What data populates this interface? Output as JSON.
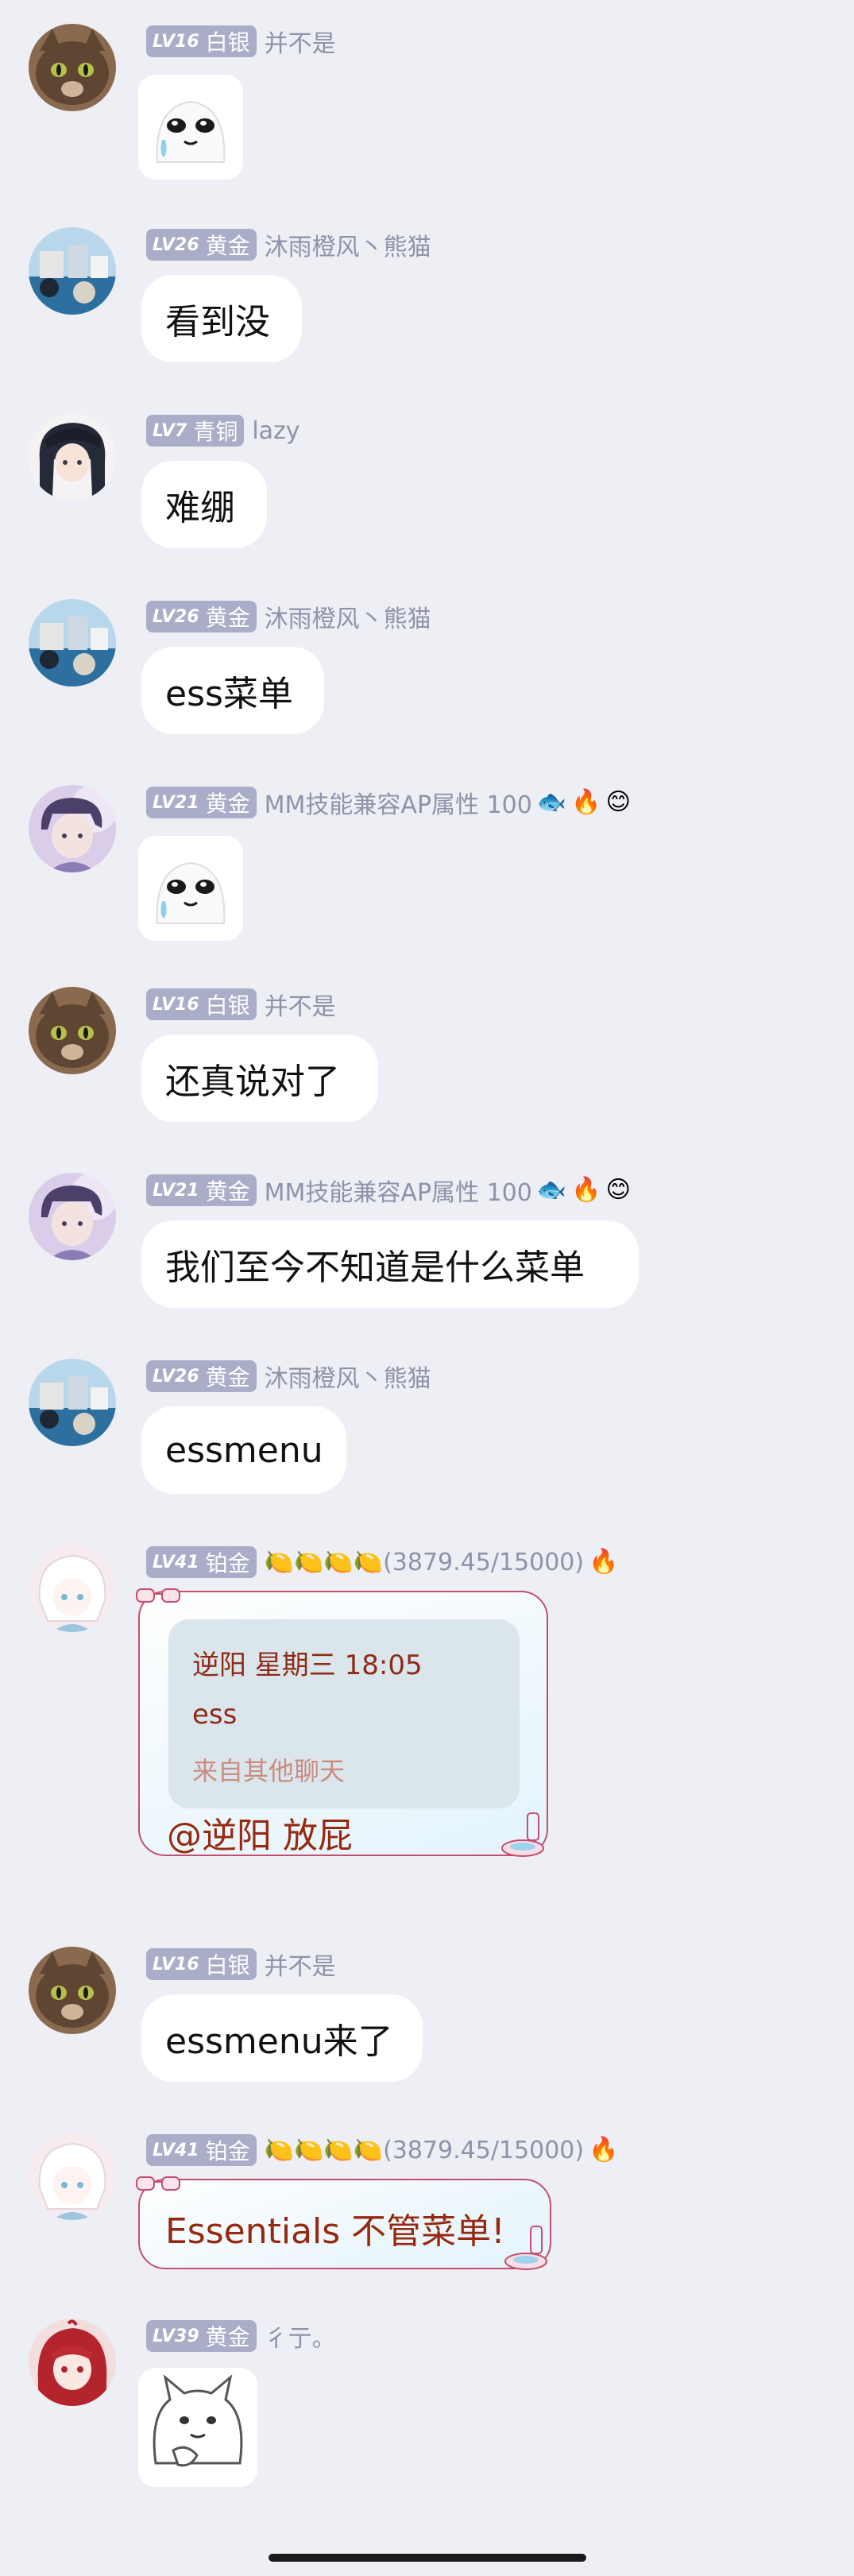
{
  "messages": [
    {
      "level": "LV16",
      "rank": "白银",
      "name": "并不是",
      "type": "sticker"
    },
    {
      "level": "LV26",
      "rank": "黄金",
      "name": "沐雨橙风丶熊猫",
      "text": "看到没"
    },
    {
      "level": "LV7",
      "rank": "青铜",
      "name": "lazy",
      "text": "难绷"
    },
    {
      "level": "LV26",
      "rank": "黄金",
      "name": "沐雨橙风丶熊猫",
      "text": "ess菜单"
    },
    {
      "level": "LV21",
      "rank": "黄金",
      "name": "MM技能兼容AP属性 100",
      "type": "sticker"
    },
    {
      "level": "LV16",
      "rank": "白银",
      "name": "并不是",
      "text": "还真说对了"
    },
    {
      "level": "LV21",
      "rank": "黄金",
      "name": "MM技能兼容AP属性 100",
      "text": "我们至今不知道是什么菜单"
    },
    {
      "level": "LV26",
      "rank": "黄金",
      "name": "沐雨橙风丶熊猫",
      "text": "essmenu"
    },
    {
      "level": "LV41",
      "rank": "铂金",
      "name": "🍋🍋🍋🍋(3879.45/15000)",
      "quote": {
        "title": "逆阳 星期三 18:05",
        "body": "ess",
        "source": "来自其他聊天"
      },
      "text": "@逆阳 放屁"
    },
    {
      "level": "LV16",
      "rank": "白银",
      "name": "并不是",
      "text": "essmenu来了"
    },
    {
      "level": "LV41",
      "rank": "铂金",
      "name": "🍋🍋🍋🍋(3879.45/15000)",
      "text": "Essentials 不管菜单!"
    },
    {
      "level": "LV39",
      "rank": "黄金",
      "name": "彳亍。",
      "type": "sticker"
    }
  ],
  "icons": {
    "badges_mm": [
      "rocket-fish-badge",
      "fire-icon",
      "smile-badge-icon"
    ],
    "badges_lemon": [
      "fire-icon"
    ]
  },
  "colors": {
    "background": "#eeeef5",
    "rank_tag": "#a9adc8",
    "bubble": "#ffffff",
    "fancy_text": "#96290f",
    "fancy_border": "#c34f70"
  }
}
